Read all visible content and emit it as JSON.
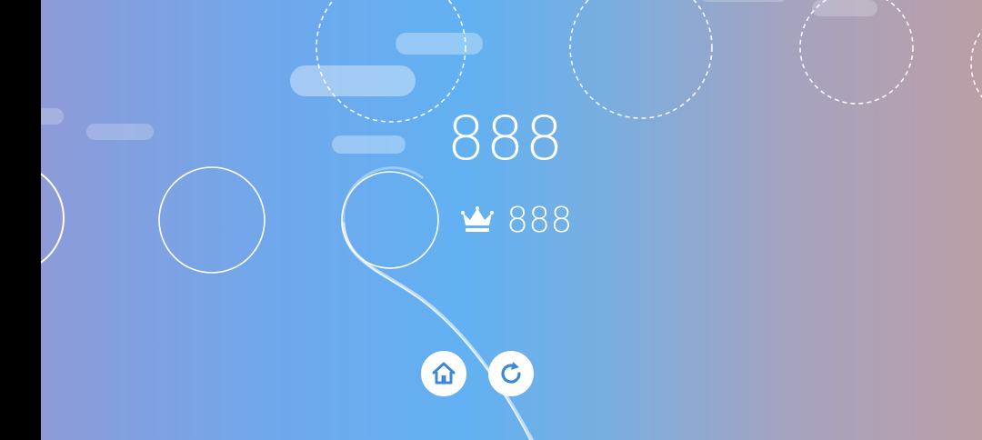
{
  "game": {
    "score": "888",
    "best_score": "888",
    "buttons": {
      "home": {
        "icon": "home-icon"
      },
      "restart": {
        "icon": "restart-icon"
      }
    },
    "icons": {
      "best": "crown-icon"
    }
  },
  "colors": {
    "gradient_left": "#8e9bd8",
    "gradient_mid": "#62b1f2",
    "gradient_right": "#bb9fa6",
    "foreground": "#ffffff",
    "button_icon": "#3c8ad6"
  }
}
